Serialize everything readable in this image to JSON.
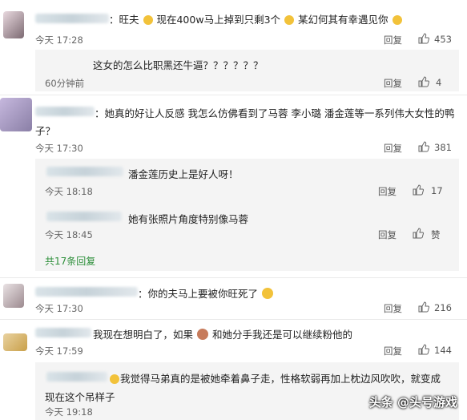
{
  "comments": [
    {
      "name_suffix": "：旺夫",
      "text_parts": [
        "现在400w马上掉到只剩3个",
        "某幻何其有幸遇见你"
      ],
      "time": "今天 17:28",
      "reply": "回复",
      "likes": "453",
      "sub": [
        {
          "text": "这女的怎么比职黑还牛逼？？？？？？",
          "time": "60分钟前",
          "reply": "回复",
          "likes": "4"
        }
      ]
    },
    {
      "name_suffix": "：",
      "text_line1": "她真的好让人反感  我怎么仿佛看到了马蓉   李小璐   潘金莲等一系列伟大女性的鸭",
      "text_line2": "子？",
      "time": "今天 17:30",
      "reply": "回复",
      "likes": "381",
      "sub": [
        {
          "text": "潘金莲历史上是好人呀！",
          "time": "今天 18:18",
          "reply": "回复",
          "likes": "17"
        },
        {
          "text": "她有张照片角度特别像马蓉",
          "time": "今天 18:45",
          "reply": "回复",
          "likes": "赞"
        }
      ],
      "more_replies": "共17条回复"
    },
    {
      "name_suffix": "：",
      "text": "你的夫马上要被你旺死了",
      "time": "今天 17:30",
      "reply": "回复",
      "likes": "216"
    },
    {
      "text_part1": "我现在想明白了，如果",
      "text_part2": "和她分手我还是可以继续粉他的",
      "time": "今天 17:59",
      "reply": "回复",
      "likes": "144",
      "sub": [
        {
          "name_fragment": "...",
          "text_line1": "我觉得马弟真的是被她牵着鼻子走，性格软弱再加上枕边风吹吹，就变成",
          "text_line2": "现在这个吊样子",
          "time": "今天 19:18"
        }
      ]
    }
  ],
  "watermark": "头条 @头号游戏",
  "colors": {
    "link_green": "#2d8f3a",
    "sub_bg": "#f4f4f4",
    "emoji": "#f2c23a"
  },
  "icons": [
    "thumb-up-icon",
    "smile-emoji-icon",
    "avatar-emoji-icon"
  ]
}
